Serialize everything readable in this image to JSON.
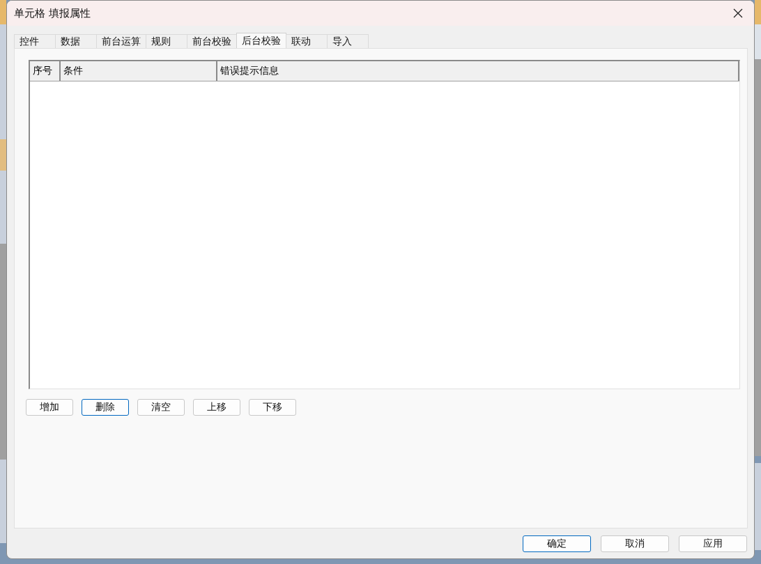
{
  "window": {
    "title": "单元格 填报属性"
  },
  "tabs": [
    {
      "label": "控件",
      "selected": false
    },
    {
      "label": "数据",
      "selected": false
    },
    {
      "label": "前台运算",
      "selected": false
    },
    {
      "label": "规则",
      "selected": false
    },
    {
      "label": "前台校验",
      "selected": false
    },
    {
      "label": "后台校验",
      "selected": true
    },
    {
      "label": "联动",
      "selected": false
    },
    {
      "label": "导入",
      "selected": false
    }
  ],
  "table": {
    "columns": [
      "序号",
      "条件",
      "错误提示信息"
    ]
  },
  "buttons": [
    {
      "label": "增加",
      "focused": false
    },
    {
      "label": "删除",
      "focused": true
    },
    {
      "label": "清空",
      "focused": false
    },
    {
      "label": "上移",
      "focused": false
    },
    {
      "label": "下移",
      "focused": false
    }
  ],
  "footer_buttons": [
    {
      "label": "确定",
      "focused": true
    },
    {
      "label": "取消",
      "focused": false
    },
    {
      "label": "应用",
      "focused": false
    }
  ]
}
